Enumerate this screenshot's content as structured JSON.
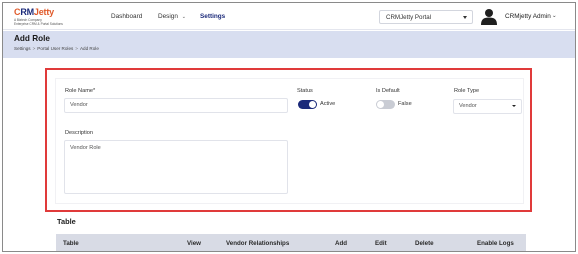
{
  "brand": {
    "logo_text_a": "C",
    "logo_text_b": "RM",
    "logo_text_c": "Jetty",
    "tagline_1": "A Biztech Company",
    "tagline_2": "Enterprise CRM & Portal Solutions"
  },
  "nav": {
    "dashboard": "Dashboard",
    "design": "Design",
    "settings": "Settings"
  },
  "portal_select": {
    "value": "CRMJetty Portal"
  },
  "user": {
    "name": "CRMjetty Admin"
  },
  "page": {
    "title": "Add Role",
    "breadcrumb": [
      "Settings",
      "Portal User Roles",
      "Add Role"
    ]
  },
  "form": {
    "role_name_label": "Role Name*",
    "role_name_value": "Vendor",
    "status_label": "Status",
    "status_text": "Active",
    "status_on": true,
    "is_default_label": "Is Default",
    "is_default_text": "False",
    "is_default_on": false,
    "role_type_label": "Role Type",
    "role_type_value": "Vendor",
    "description_label": "Description",
    "description_value": "Vendor Role"
  },
  "table": {
    "title": "Table",
    "columns": [
      "Table",
      "View",
      "Vendor Relationships",
      "Add",
      "Edit",
      "Delete",
      "Enable Logs"
    ]
  },
  "colors": {
    "brand_navy": "#1b2a7a",
    "brand_orange": "#e05a2a",
    "highlight_red": "#e03a3a",
    "header_band": "#d8def0",
    "table_header": "#d8dbe5"
  }
}
